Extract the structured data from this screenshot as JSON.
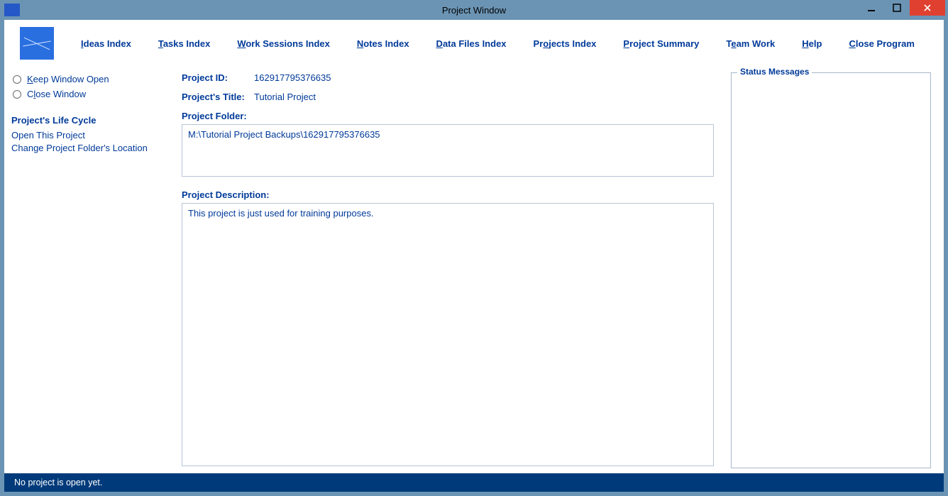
{
  "window": {
    "title": "Project Window"
  },
  "menu": {
    "ideas": "Ideas Index",
    "tasks": "Tasks Index",
    "work_sessions": "Work Sessions Index",
    "notes": "Notes Index",
    "data_files": "Data Files Index",
    "projects": "Projects Index",
    "project_summary": "Project Summary",
    "team_work": "Team Work",
    "help": "Help",
    "close_program": "Close Program"
  },
  "left": {
    "keep_open": "Keep Window Open",
    "close_window": "Close Window",
    "life_cycle_title": "Project's Life Cycle",
    "open_project": "Open This Project",
    "change_folder": "Change Project Folder's Location"
  },
  "fields": {
    "project_id_label": "Project ID:",
    "project_id_value": "162917795376635",
    "project_title_label": "Project's Title:",
    "project_title_value": "Tutorial Project",
    "project_folder_label": "Project Folder:",
    "project_folder_value": "M:\\Tutorial Project Backups\\162917795376635",
    "project_desc_label": "Project Description:",
    "project_desc_value": "This project is just used for training purposes."
  },
  "status_group_title": "Status Messages",
  "statusbar": "No project is open yet."
}
